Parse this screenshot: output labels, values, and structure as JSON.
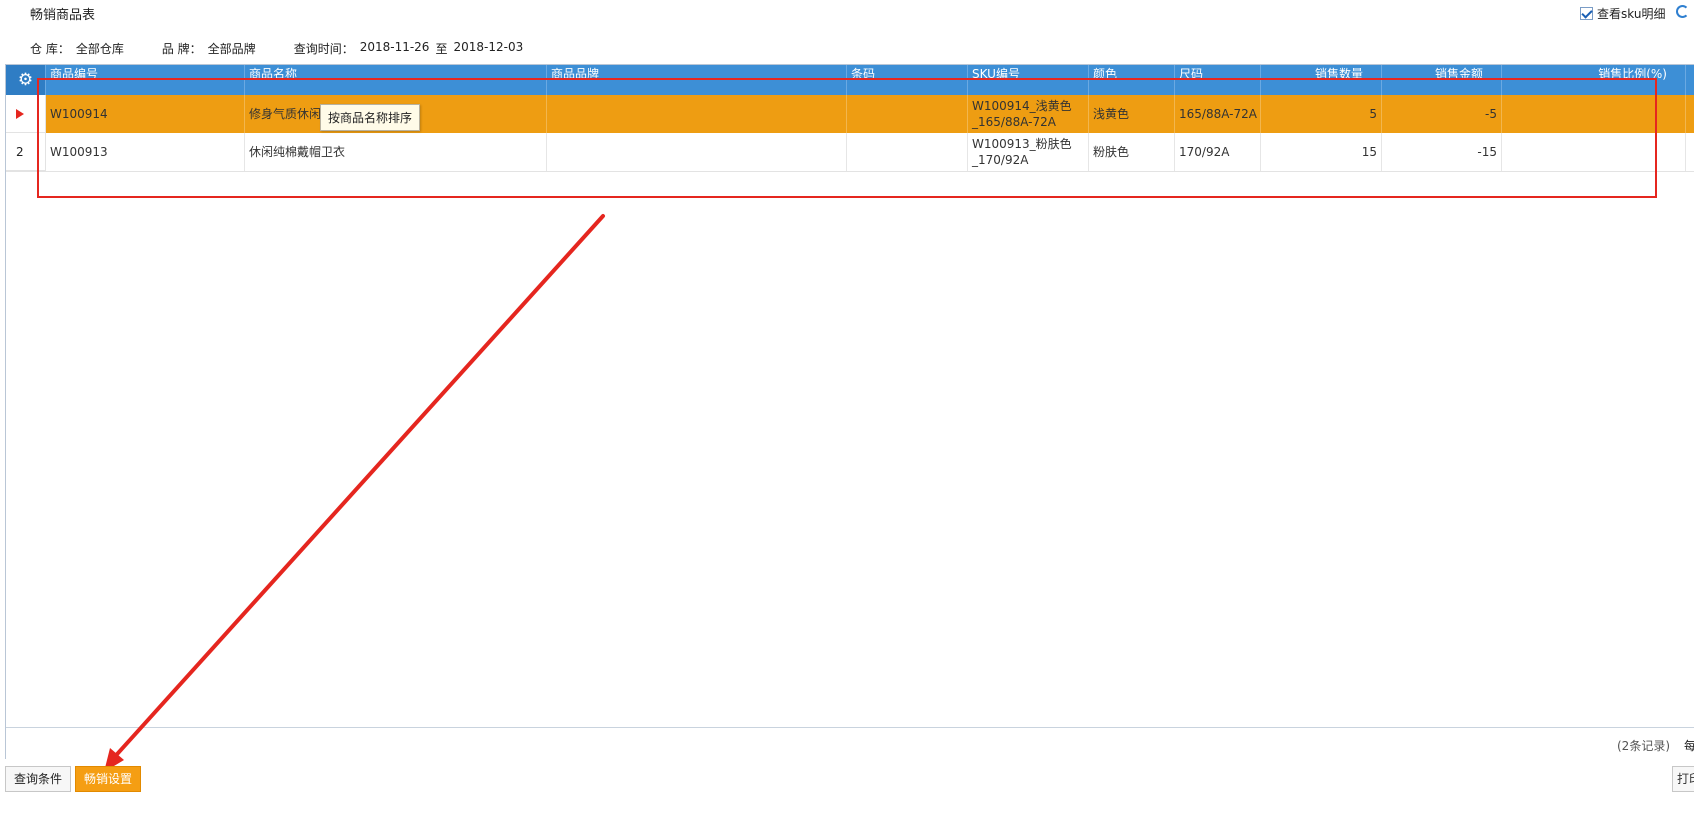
{
  "page": {
    "title": "畅销商品表"
  },
  "options": {
    "sku_detail_label": "查看sku明细"
  },
  "filters": {
    "warehouse_label": "仓 库：",
    "warehouse_value": "全部仓库",
    "brand_label": "品 牌：",
    "brand_value": "全部品牌",
    "date_label": "查询时间：",
    "date_from": "2018-11-26",
    "date_sep": "至",
    "date_to": "2018-12-03"
  },
  "grid": {
    "columns": [
      "商品编号",
      "商品名称",
      "商品品牌",
      "条码",
      "SKU编号",
      "颜色",
      "尺码",
      "销售数量",
      "销售金额",
      "销售比例(%)"
    ],
    "rows": [
      {
        "row_label": "",
        "code": "W100914",
        "name": "修身气质休闲",
        "brand": "",
        "barcode": "",
        "sku_line1": "W100914_浅黄色",
        "sku_line2": "_165/88A-72A",
        "color": "浅黄色",
        "size": "165/88A-72A",
        "qty": "5",
        "amount": "-5",
        "ratio": ""
      },
      {
        "row_label": "2",
        "code": "W100913",
        "name": "休闲纯棉戴帽卫衣",
        "brand": "",
        "barcode": "",
        "sku_line1": "W100913_粉肤色",
        "sku_line2": "_170/92A",
        "color": "粉肤色",
        "size": "170/92A",
        "qty": "15",
        "amount": "-15",
        "ratio": ""
      }
    ],
    "tooltip": "按商品名称排序",
    "record_count": "(2条记录)",
    "footer_clip": "每"
  },
  "buttons": {
    "query": "查询条件",
    "settings": "畅销设置",
    "print": "打印"
  },
  "annotations": {
    "color": "#e5261f"
  }
}
